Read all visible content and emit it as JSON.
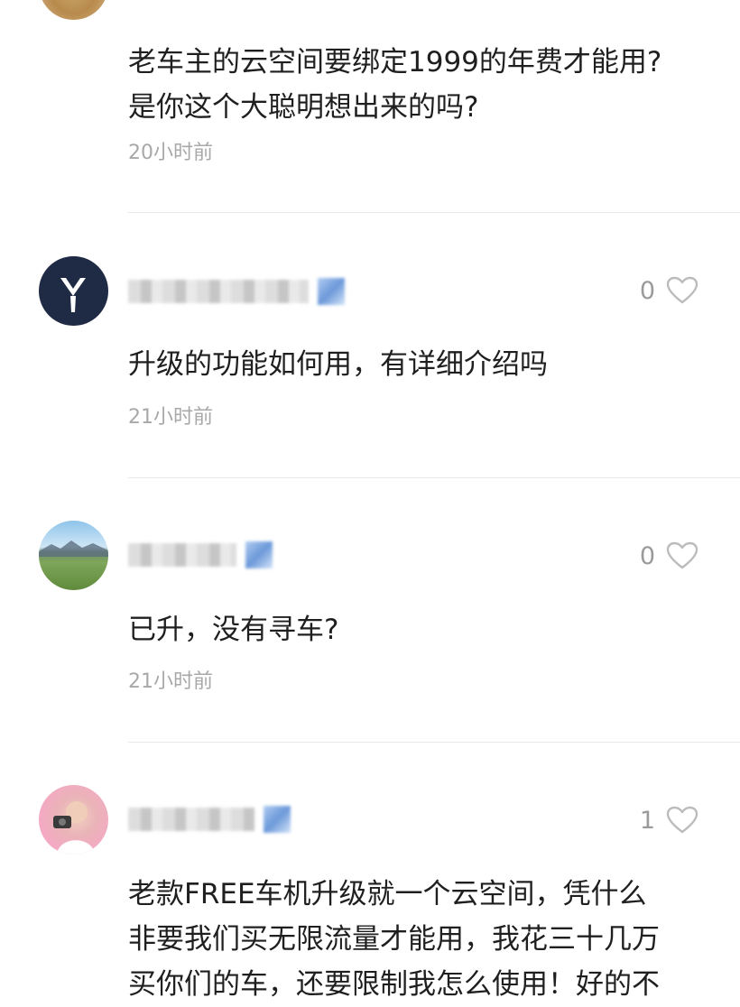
{
  "comments": [
    {
      "text": "老车主的云空间要绑定1999的年费才能用?\n是你这个大聪明想出来的吗?",
      "time": "20小时前"
    },
    {
      "likes": "0",
      "text": "升级的功能如何用，有详细介绍吗",
      "time": "21小时前",
      "avatar_icon": "logo-avatar-icon"
    },
    {
      "likes": "0",
      "text": "已升，没有寻车?",
      "time": "21小时前",
      "avatar_icon": "landscape-avatar-icon"
    },
    {
      "likes": "1",
      "text": "老款FREE车机升级就一个云空间，凭什么\n非要我们买无限流量才能用，我花三十几万\n买你们的车，还要限制我怎么使用！好的不",
      "avatar_icon": "child-photo-avatar-icon"
    }
  ],
  "colors": {
    "text": "#1f1f1f",
    "muted": "#a8a8a8",
    "heart_outline": "#bcbcbc",
    "divider": "#e8e8e8"
  }
}
